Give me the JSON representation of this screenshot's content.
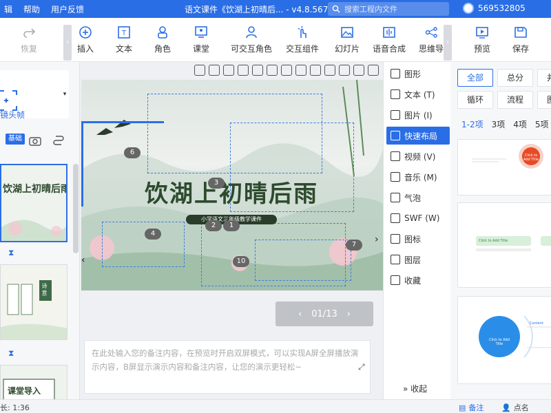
{
  "titlebar": {
    "menu": [
      "辑",
      "帮助",
      "用户反馈"
    ],
    "title": "语文课件《饮湖上初晴后...",
    "version": "v4.8.567",
    "search_placeholder": "搜索工程内文件",
    "user_id": "569532805",
    "bg_color": "#2a6ee6"
  },
  "toolbar": {
    "undo": "恢复",
    "insert": "插入",
    "text": "文本",
    "role": "角色",
    "classroom": "课堂",
    "interactive_role": "可交互角色",
    "interactive_widget": "交互组件",
    "slideshow": "幻灯片",
    "speech": "语音合成",
    "mindmap": "思维导",
    "preview": "预览",
    "save": "保存"
  },
  "leftpanel": {
    "lens_label": "镜头帧",
    "tag": "基础",
    "thumb1_title": "饮湖上初晴后雨",
    "thumb2_text": "诗 意",
    "thumb3_title": "课堂导入"
  },
  "slide": {
    "title": "饮湖上初晴后雨",
    "subtitle": "小学语文三年级教学课件",
    "badges": [
      "6",
      "3",
      "2",
      "4",
      "1",
      "10",
      "7"
    ]
  },
  "pager": {
    "text": "01/13"
  },
  "notes": {
    "placeholder": "在此处输入您的备注内容，在预览时开启双屏模式，可以实现A屏全屏播放演示内容，B屏显示演示内容和备注内容，让您的演示更轻松~"
  },
  "compmenu": {
    "items": [
      {
        "label": "图形",
        "icon": "shape-icon"
      },
      {
        "label": "文本 (T)",
        "icon": "text-icon"
      },
      {
        "label": "图片 (I)",
        "icon": "image-icon"
      },
      {
        "label": "快速布局",
        "icon": "layout-icon"
      },
      {
        "label": "视频 (V)",
        "icon": "video-icon"
      },
      {
        "label": "音乐 (M)",
        "icon": "music-icon"
      },
      {
        "label": "气泡",
        "icon": "bubble-icon"
      },
      {
        "label": "SWF (W)",
        "icon": "swf-icon"
      },
      {
        "label": "图标",
        "icon": "icons-icon"
      },
      {
        "label": "图层",
        "icon": "layer-icon"
      },
      {
        "label": "收藏",
        "icon": "star-icon"
      }
    ],
    "active_index": 3,
    "collapse": "收起"
  },
  "rightpanel": {
    "tags": [
      "全部",
      "总分",
      "并",
      "循环",
      "流程",
      "图"
    ],
    "counts": [
      "1-2项",
      "3项",
      "4项",
      "5项"
    ],
    "tpl1_center": "Click to Add Title",
    "tpl3_center": "Click to Add Title",
    "tpl3_content": "Content",
    "tpl2_label": "Click to Add Title"
  },
  "statusbar": {
    "duration": "长: 1:36",
    "notes": "备注",
    "rollcall": "点名"
  }
}
